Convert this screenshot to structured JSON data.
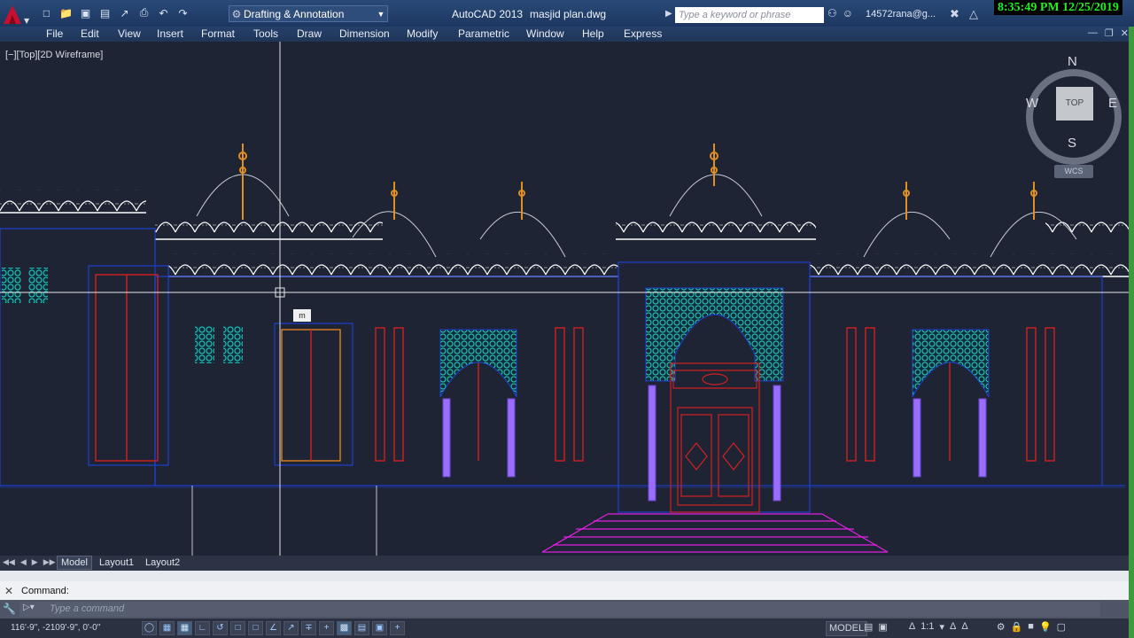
{
  "titlebar": {
    "workspace": "Drafting & Annotation",
    "app_title": "AutoCAD 2013",
    "file_name": "masjid plan.dwg",
    "search_placeholder": "Type a keyword or phrase",
    "user": "14572rana@g...",
    "clock": "8:35:49 PM 12/25/2019"
  },
  "menu": {
    "items": [
      "File",
      "Edit",
      "View",
      "Insert",
      "Format",
      "Tools",
      "Draw",
      "Dimension",
      "Modify",
      "Parametric",
      "Window",
      "Help",
      "Express"
    ]
  },
  "viewport": {
    "label": "[−][Top][2D Wireframe]",
    "viewcube": {
      "top": "TOP",
      "north": "N",
      "south": "S",
      "east": "E",
      "west": "W",
      "wcs": "WCS"
    },
    "cursor_tooltip": "m"
  },
  "layout_tabs": [
    "Model",
    "Layout1",
    "Layout2"
  ],
  "active_tab": "Model",
  "command": {
    "history": "Command:",
    "placeholder": "Type a command"
  },
  "status": {
    "coordinates": "116'-9\", -2109'-9\", 0'-0\"",
    "model": "MODEL",
    "scale": "1:1"
  },
  "colors": {
    "background": "#1e2433",
    "titlebar": "#1c3660",
    "clock_text": "#22ee22",
    "walls": "#1f3fd0",
    "doors": "#d42020",
    "stairs": "#e020e0",
    "screen": "#2ed0c8",
    "columns": "#9a6cff",
    "minarets": "#e09020"
  }
}
